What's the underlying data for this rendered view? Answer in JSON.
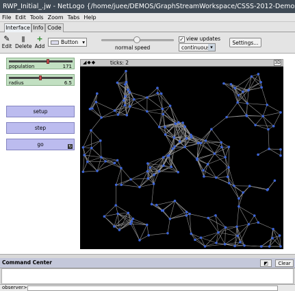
{
  "window": {
    "title": "RWP_Initial_.jw - NetLogo {/home/juee/DEMOS/GraphStreamWorkspace/CSSS-2012-Demos/netL..."
  },
  "menu": [
    "File",
    "Edit",
    "Tools",
    "Zoom",
    "Tabs",
    "Help"
  ],
  "tabs": [
    "Interface",
    "Info",
    "Code"
  ],
  "toolbar": {
    "edit": "Edit",
    "delete": "Delete",
    "add": "Add",
    "widget_type": "Button",
    "speed_label": "normal speed",
    "view_updates_label": "view updates",
    "view_updates_checked": true,
    "update_mode": "continuous",
    "settings": "Settings..."
  },
  "sliders": [
    {
      "label": "population",
      "value": "171",
      "fraction": 0.66
    },
    {
      "label": "radius",
      "value": "6.5",
      "fraction": 0.52
    }
  ],
  "buttons": [
    {
      "label": "setup"
    },
    {
      "label": "step"
    },
    {
      "label": "go",
      "forever": true
    }
  ],
  "view": {
    "ticks_text": "ticks: 2",
    "three_d": "3D",
    "node_color": "#3c64d6",
    "link_color": "#9a9a9a",
    "background": "#000000"
  },
  "command_center": {
    "title": "Command Center",
    "clear": "Clear",
    "context": "observer>"
  }
}
